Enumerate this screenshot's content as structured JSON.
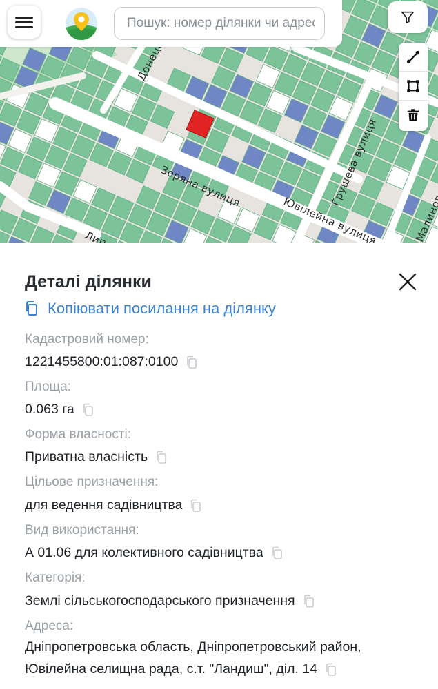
{
  "search": {
    "placeholder": "Пошук: номер ділянки чи адресу"
  },
  "map": {
    "streets": {
      "zoryana": "Зоряна вулиця",
      "yuvileina": "Ювілейна вулиця",
      "grusheva": "Грушева вулиця",
      "donetska": "Донецька",
      "lypova": "Лип",
      "malynova": "Малинова"
    },
    "colors": {
      "parcel_green": "#7cc39a",
      "parcel_blue": "#6f87c4",
      "selected": "#e02424",
      "park": "#c8e4c8",
      "road": "#ffffff"
    }
  },
  "details": {
    "title": "Деталі ділянки",
    "copy_link": "Копіювати посилання на ділянку",
    "fields": [
      {
        "label": "Кадастровий номер:",
        "value": "1221455800:01:087:0100"
      },
      {
        "label": "Площа:",
        "value": "0.063 га"
      },
      {
        "label": "Форма власності:",
        "value": "Приватна власність"
      },
      {
        "label": "Цільове призначення:",
        "value": "для ведення садівництва"
      },
      {
        "label": "Вид використання:",
        "value": "А 01.06 для колективного садівництва"
      },
      {
        "label": "Категорія:",
        "value": "Землі сільськогосподарського призначення"
      },
      {
        "label": "Адреса:",
        "value_line1": "Дніпропетровська область, Дніпропетровський район,",
        "value_line2": "Ювілейна селищна рада, с.т. \"Ландиш\", діл. 14"
      }
    ]
  }
}
